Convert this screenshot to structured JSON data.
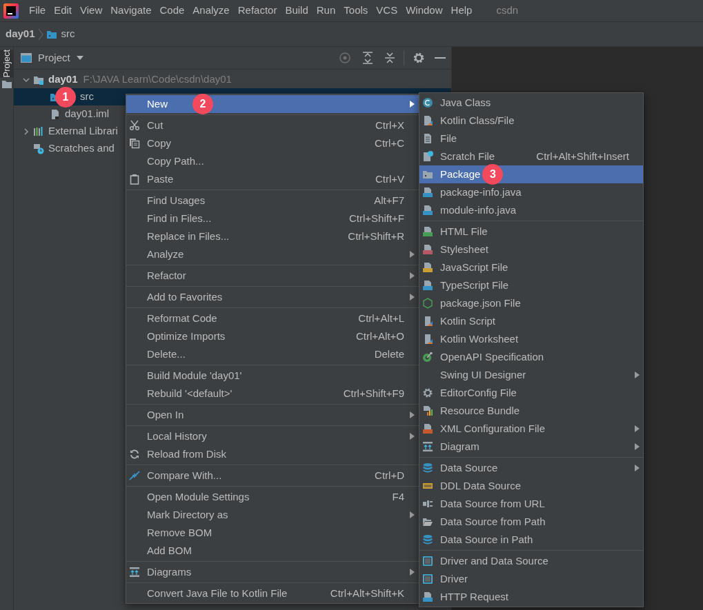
{
  "menu_bar": {
    "items": [
      {
        "label": "File"
      },
      {
        "label": "Edit"
      },
      {
        "label": "View"
      },
      {
        "label": "Navigate"
      },
      {
        "label": "Code"
      },
      {
        "label": "Analyze"
      },
      {
        "label": "Refactor"
      },
      {
        "label": "Build"
      },
      {
        "label": "Run"
      },
      {
        "label": "Tools"
      },
      {
        "label": "VCS"
      },
      {
        "label": "Window"
      },
      {
        "label": "Help"
      }
    ],
    "project_name": "csdn"
  },
  "breadcrumb": [
    {
      "label": "day01"
    },
    {
      "label": "src"
    }
  ],
  "tool_stripe": {
    "tabs": [
      {
        "label": "Project",
        "selected": true
      }
    ]
  },
  "project_panel": {
    "title": "Project",
    "tree": [
      {
        "label": "day01",
        "path": "F:\\JAVA Learn\\Code\\csdn\\day01",
        "expanded": true,
        "selected": false,
        "children": [
          {
            "label": "src",
            "selected": true,
            "badge": "1"
          },
          {
            "label": "day01.iml",
            "selected": false
          }
        ]
      },
      {
        "label": "External Librari",
        "expanded": false,
        "selected": false
      },
      {
        "label": "Scratches and",
        "selected": false
      }
    ]
  },
  "context_menu": {
    "groups": [
      [
        {
          "label": "New",
          "submenu": true,
          "selected": true,
          "badge": "2"
        }
      ],
      [
        {
          "label": "Cut",
          "shortcut": "Ctrl+X",
          "selected": false
        },
        {
          "label": "Copy",
          "shortcut": "Ctrl+C",
          "selected": false
        },
        {
          "label": "Copy Path...",
          "selected": false
        },
        {
          "label": "Paste",
          "shortcut": "Ctrl+V",
          "selected": false
        }
      ],
      [
        {
          "label": "Find Usages",
          "shortcut": "Alt+F7",
          "selected": false
        },
        {
          "label": "Find in Files...",
          "shortcut": "Ctrl+Shift+F",
          "selected": false
        },
        {
          "label": "Replace in Files...",
          "shortcut": "Ctrl+Shift+R",
          "selected": false
        },
        {
          "label": "Analyze",
          "submenu": true,
          "selected": false
        }
      ],
      [
        {
          "label": "Refactor",
          "submenu": true,
          "selected": false
        }
      ],
      [
        {
          "label": "Add to Favorites",
          "submenu": true,
          "selected": false
        }
      ],
      [
        {
          "label": "Reformat Code",
          "shortcut": "Ctrl+Alt+L",
          "selected": false
        },
        {
          "label": "Optimize Imports",
          "shortcut": "Ctrl+Alt+O",
          "selected": false
        },
        {
          "label": "Delete...",
          "shortcut": "Delete",
          "selected": false
        }
      ],
      [
        {
          "label": "Build Module 'day01'",
          "selected": false
        },
        {
          "label": "Rebuild '<default>'",
          "shortcut": "Ctrl+Shift+F9",
          "selected": false
        }
      ],
      [
        {
          "label": "Open In",
          "submenu": true,
          "selected": false
        }
      ],
      [
        {
          "label": "Local History",
          "submenu": true,
          "selected": false
        },
        {
          "label": "Reload from Disk",
          "selected": false
        }
      ],
      [
        {
          "label": "Compare With...",
          "shortcut": "Ctrl+D",
          "selected": false
        }
      ],
      [
        {
          "label": "Open Module Settings",
          "shortcut": "F4",
          "selected": false
        },
        {
          "label": "Mark Directory as",
          "submenu": true,
          "selected": false
        },
        {
          "label": "Remove BOM",
          "selected": false
        },
        {
          "label": "Add BOM",
          "selected": false
        }
      ],
      [
        {
          "label": "Diagrams",
          "submenu": true,
          "selected": false
        }
      ],
      [
        {
          "label": "Convert Java File to Kotlin File",
          "shortcut": "Ctrl+Alt+Shift+K",
          "selected": false
        }
      ]
    ]
  },
  "submenu": {
    "groups": [
      [
        {
          "label": "Java Class",
          "selected": false
        },
        {
          "label": "Kotlin Class/File",
          "selected": false
        },
        {
          "label": "File",
          "selected": false
        },
        {
          "label": "Scratch File",
          "shortcut": "Ctrl+Alt+Shift+Insert",
          "selected": false
        },
        {
          "label": "Package",
          "selected": true,
          "badge": "3"
        },
        {
          "label": "package-info.java",
          "selected": false
        },
        {
          "label": "module-info.java",
          "selected": false
        }
      ],
      [
        {
          "label": "HTML File",
          "selected": false
        },
        {
          "label": "Stylesheet",
          "selected": false
        },
        {
          "label": "JavaScript File",
          "selected": false
        },
        {
          "label": "TypeScript File",
          "selected": false
        },
        {
          "label": "package.json File",
          "selected": false
        },
        {
          "label": "Kotlin Script",
          "selected": false
        },
        {
          "label": "Kotlin Worksheet",
          "selected": false
        },
        {
          "label": "OpenAPI Specification",
          "selected": false
        },
        {
          "label": "Swing UI Designer",
          "submenu": true,
          "selected": false
        },
        {
          "label": "EditorConfig File",
          "selected": false
        },
        {
          "label": "Resource Bundle",
          "selected": false
        },
        {
          "label": "XML Configuration File",
          "submenu": true,
          "selected": false
        },
        {
          "label": "Diagram",
          "submenu": true,
          "selected": false
        }
      ],
      [
        {
          "label": "Data Source",
          "submenu": true,
          "selected": false
        },
        {
          "label": "DDL Data Source",
          "selected": false
        },
        {
          "label": "Data Source from URL",
          "selected": false
        },
        {
          "label": "Data Source from Path",
          "selected": false
        },
        {
          "label": "Data Source in Path",
          "selected": false
        }
      ],
      [
        {
          "label": "Driver and Data Source",
          "selected": false
        },
        {
          "label": "Driver",
          "selected": false
        },
        {
          "label": "HTTP Request",
          "selected": false
        }
      ]
    ]
  }
}
